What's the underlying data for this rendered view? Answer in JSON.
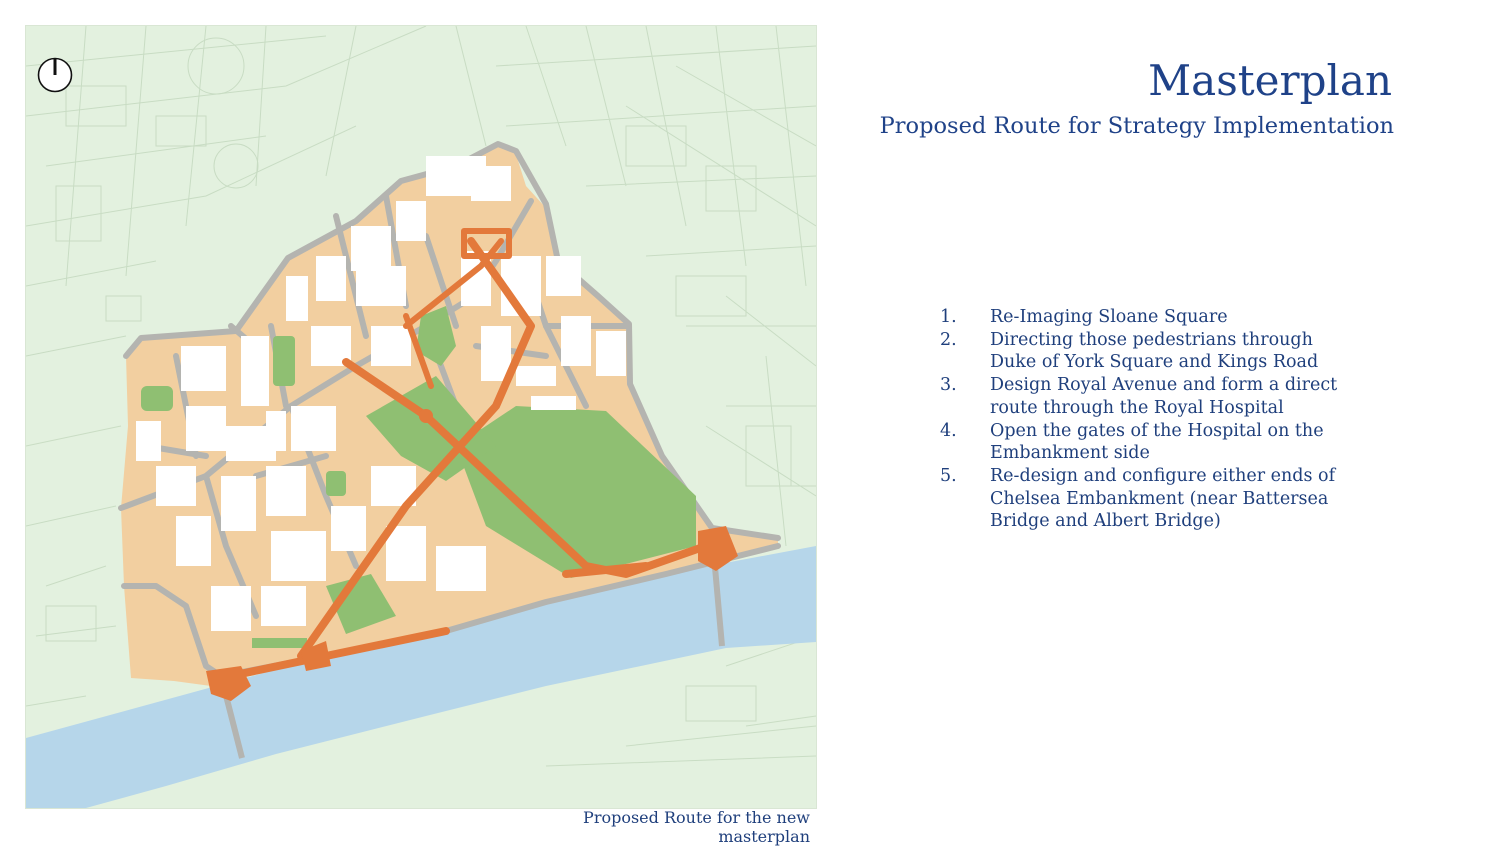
{
  "header": {
    "title": "Masterplan",
    "subtitle": "Proposed Route for Strategy Implementation"
  },
  "steps": [
    {
      "number": "1.",
      "text": "Re-Imaging Sloane Square"
    },
    {
      "number": "2.",
      "text": "Directing those pedestrians through Duke of York Square and Kings Road"
    },
    {
      "number": "3.",
      "text": "Design Royal Avenue and form a direct route through the Royal Hospital"
    },
    {
      "number": "4.",
      "text": "Open the gates of the Hospital on the Embankment side"
    },
    {
      "number": "5.",
      "text": "Re-design and configure either ends of Chelsea Embankment (near Battersea Bridge and Albert Bridge)"
    }
  ],
  "map": {
    "caption": "Proposed Route for the new masterplan",
    "north_arrow_icon": "north-arrow-icon",
    "colors": {
      "background": "#e3f1df",
      "context_lines": "#bfd5ba",
      "study_area": "#f2cfa0",
      "roads": "#b4b4b0",
      "buildings": "#ffffff",
      "green_space": "#8fbf72",
      "river": "#b6d6ea",
      "proposed_route": "#e3793b"
    }
  }
}
